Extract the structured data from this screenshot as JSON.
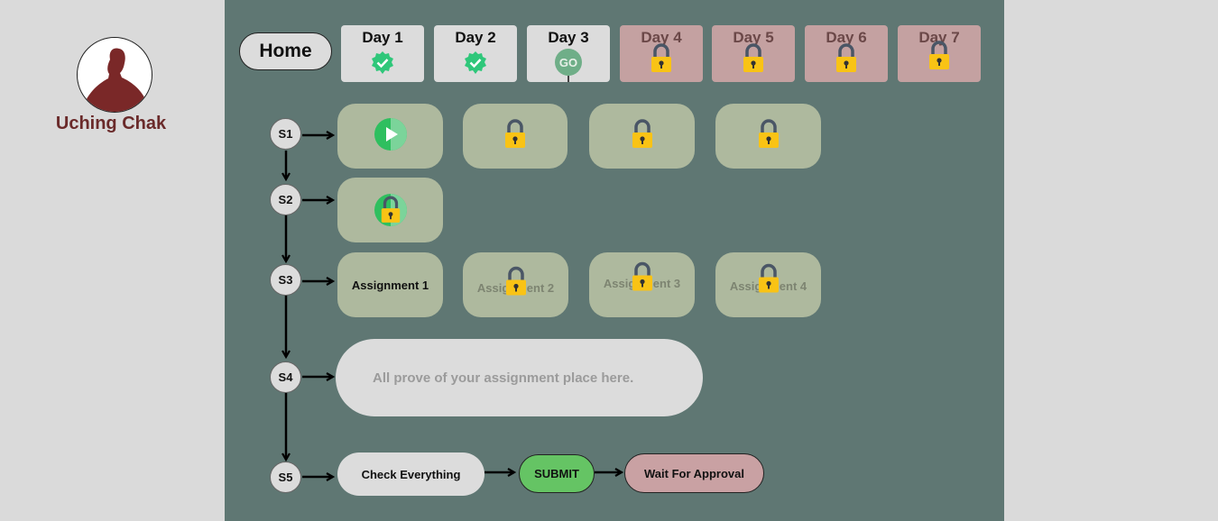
{
  "user": {
    "name": "Uching Chak"
  },
  "nav": {
    "home_label": "Home",
    "days": [
      {
        "label": "Day 1",
        "status": "complete",
        "icon": "check-badge-icon"
      },
      {
        "label": "Day 2",
        "status": "complete",
        "icon": "check-badge-icon"
      },
      {
        "label": "Day 3",
        "status": "current",
        "icon": "go-icon",
        "icon_text": "GO"
      },
      {
        "label": "Day 4",
        "status": "locked",
        "icon": "lock-icon"
      },
      {
        "label": "Day 5",
        "status": "locked",
        "icon": "lock-icon"
      },
      {
        "label": "Day 6",
        "status": "locked",
        "icon": "lock-icon"
      },
      {
        "label": "Day 7",
        "status": "locked",
        "icon": "lock-icon"
      }
    ]
  },
  "steps": [
    {
      "label": "S1",
      "items": [
        {
          "type": "video",
          "icon": "play-icon"
        },
        {
          "type": "locked",
          "icon": "lock-icon"
        },
        {
          "type": "locked",
          "icon": "lock-icon"
        },
        {
          "type": "locked",
          "icon": "lock-icon"
        }
      ]
    },
    {
      "label": "S2",
      "items": [
        {
          "type": "locked-progress",
          "icon": "lock-icon"
        }
      ]
    },
    {
      "label": "S3",
      "items": [
        {
          "type": "assignment",
          "label": "Assignment 1",
          "locked": false
        },
        {
          "type": "assignment",
          "label": "Assignment 2",
          "locked": true
        },
        {
          "type": "assignment",
          "label": "Assignment 3",
          "locked": true
        },
        {
          "type": "assignment",
          "label": "Assignment 4",
          "locked": true
        }
      ]
    },
    {
      "label": "S4",
      "dropzone_text": "All prove of your assignment place here."
    },
    {
      "label": "S5",
      "check_label": "Check Everything",
      "submit_label": "SUBMIT",
      "wait_label": "Wait For Approval"
    }
  ],
  "colors": {
    "panel": "#5f7773",
    "card": "#aeb99e",
    "locked_tab": "#c4a1a1",
    "submit": "#65c464",
    "wait": "#c9a1a3",
    "username": "#6a2a2a"
  }
}
